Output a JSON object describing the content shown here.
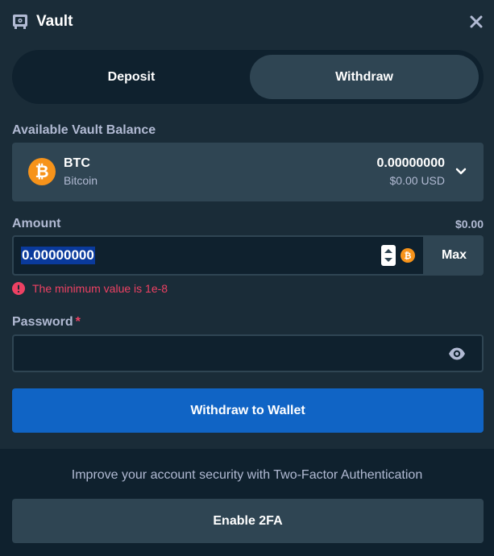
{
  "header": {
    "title": "Vault",
    "icon": "vault-icon",
    "close_icon": "close-icon"
  },
  "tabs": [
    {
      "label": "Deposit",
      "active": false
    },
    {
      "label": "Withdraw",
      "active": true
    }
  ],
  "balance": {
    "label": "Available Vault Balance",
    "currency_code": "BTC",
    "currency_name": "Bitcoin",
    "amount": "0.00000000",
    "usd": "$0.00 USD",
    "icon": "bitcoin-icon"
  },
  "amount": {
    "label": "Amount",
    "usd_value": "$0.00",
    "value": "0.00000000",
    "max_label": "Max",
    "error": "The minimum value is 1e-8"
  },
  "password": {
    "label": "Password",
    "required_mark": "*",
    "value": ""
  },
  "withdraw_button": "Withdraw to Wallet",
  "footer": {
    "info": "Improve your account security with Two-Factor Authentication",
    "button": "Enable 2FA"
  },
  "colors": {
    "background": "#1a2c38",
    "surface": "#2f4553",
    "input_bg": "#0f212e",
    "primary": "#1064c5",
    "bitcoin": "#f7931a",
    "error": "#ed4163"
  }
}
